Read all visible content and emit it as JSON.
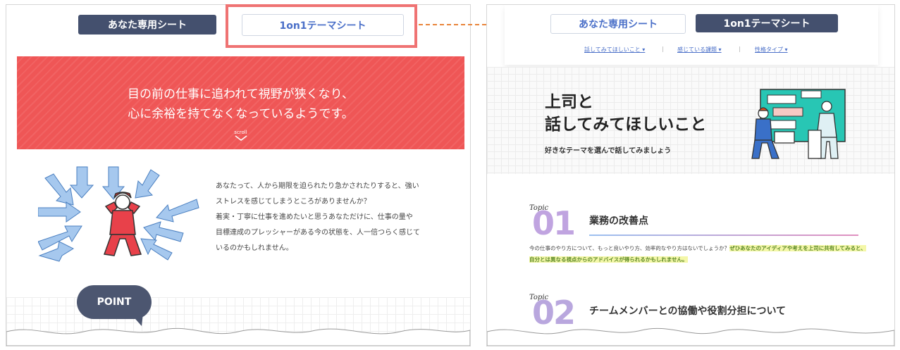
{
  "left": {
    "tabs": {
      "my_sheet": "あなた専用シート",
      "oneonone_sheet": "1on1テーマシート"
    },
    "banner": {
      "line1": "目の前の仕事に追われて視野が狭くなり、",
      "line2": "心に余裕を持てなくなっているようです。",
      "scroll": "scroll"
    },
    "description": [
      "あなたって、人から期限を迫られたり急かされたりすると、強い",
      "ストレスを感じてしまうところがありませんか？",
      "着実・丁寧に仕事を進めたいと思うあなただけに、仕事の量や",
      "目標達成のプレッシャーがある今の状態を、人一倍つらく感じて",
      "いるのかもしれません。"
    ],
    "point_label": "POINT"
  },
  "right": {
    "tabs": {
      "my_sheet": "あなた専用シート",
      "oneonone_sheet": "1on1テーマシート"
    },
    "nav": [
      "話してみてほしいこと ▾",
      "感じている課題 ▾",
      "性格タイプ ▾"
    ],
    "hero": {
      "title_line1": "上司と",
      "title_line2": "話してみてほしいこと",
      "subtitle": "好きなテーマを選んで話してみましょう"
    },
    "topics": [
      {
        "label": "Topic",
        "number": "01",
        "title": "業務の改善点",
        "text_plain": "今の仕事のやり方について、もっと良いやり方、効率的なやり方はないでしょうか？",
        "text_highlight": "ぜひあなたのアイディアや考えを上司に共有してみると、自分とは異なる視点からのアドバイスが得られるかもしれません。"
      },
      {
        "label": "Topic",
        "number": "02",
        "title": "チームメンバーとの協働や役割分担について"
      }
    ]
  },
  "colors": {
    "dark_tab": "#44506e",
    "accent_blue": "#4a6fc8",
    "banner_red": "#ef5656",
    "highlight_box": "#ef7373",
    "arrow": "#e8843a"
  }
}
